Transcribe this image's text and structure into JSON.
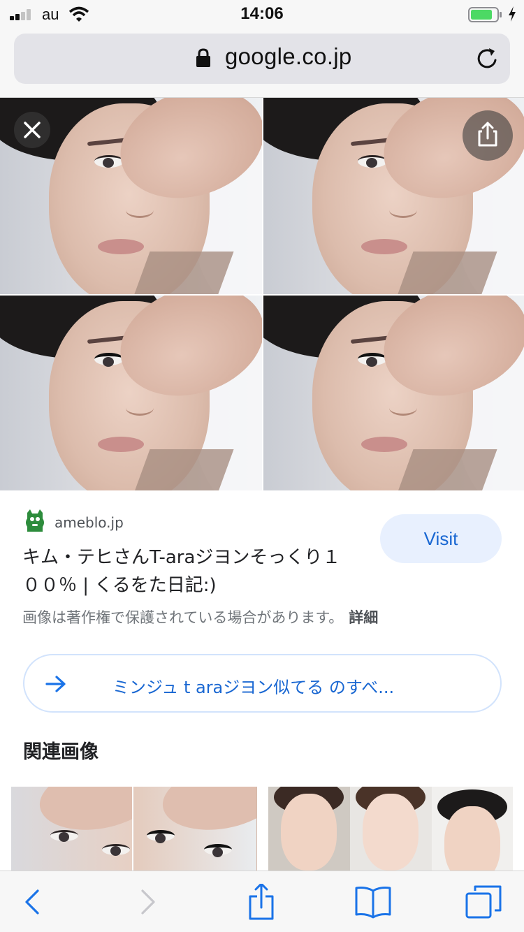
{
  "status_bar": {
    "carrier": "au",
    "time": "14:06"
  },
  "browser": {
    "url": "google.co.jp",
    "icons": {
      "lock": "lock-icon",
      "reload": "reload-icon",
      "back": "chevron-left-icon",
      "forward": "chevron-right-icon",
      "share": "share-icon",
      "bookmarks": "book-icon",
      "tabs": "tabs-icon"
    },
    "accent_color": "#1a73e8"
  },
  "image_viewer": {
    "close_icon": "close-icon",
    "share_icon": "share-icon"
  },
  "result": {
    "site_name": "ameblo.jp",
    "title": "キム・テヒさんT-araジヨンそっくり１００％ | くるをた日記:)",
    "visit_label": "Visit",
    "copyright_notice": "画像は著作権で保護されている場合があります。",
    "details_label": "詳細"
  },
  "related_search": {
    "label": "ミンジュ t araジヨン似てる のすべ..."
  },
  "related_images": {
    "heading": "関連画像"
  }
}
